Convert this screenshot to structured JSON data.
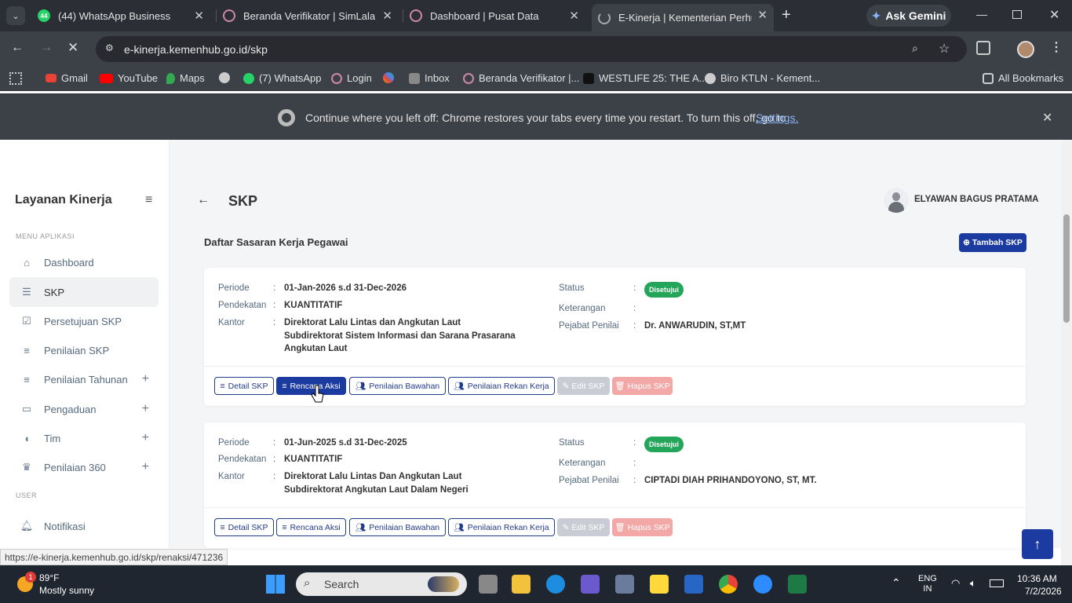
{
  "browser": {
    "tabs": [
      {
        "label": "(44) WhatsApp Business",
        "badge": "44"
      },
      {
        "label": "Beranda Verifikator | SimLala"
      },
      {
        "label": "Dashboard | Pusat Data"
      },
      {
        "label": "E-Kinerja | Kementerian Perhub"
      }
    ],
    "ask_gemini": "Ask Gemini",
    "url": "e-kinerja.kemenhub.go.id/skp",
    "bookmarks": [
      "Gmail",
      "YouTube",
      "Maps",
      "(7) WhatsApp",
      "Login",
      "Inbox",
      "Beranda Verifikator |...",
      "WESTLIFE 25: THE A...",
      "Biro KTLN - Kement..."
    ],
    "bookmark_badge": "44",
    "all_bookmarks": "All Bookmarks",
    "restore_message": "Continue where you left off: Chrome restores your tabs every time you restart. To turn this off, go to",
    "restore_link": "Settings.",
    "status_url": "https://e-kinerja.kemenhub.go.id/skp/renaksi/471236"
  },
  "sidebar": {
    "brand": "Layanan Kinerja",
    "section_menu": "MENU APLIKASI",
    "items": [
      {
        "label": "Dashboard"
      },
      {
        "label": "SKP"
      },
      {
        "label": "Persetujuan SKP"
      },
      {
        "label": "Penilaian SKP"
      },
      {
        "label": "Penilaian Tahunan"
      },
      {
        "label": "Pengaduan"
      },
      {
        "label": "Tim"
      },
      {
        "label": "Penilaian 360"
      }
    ],
    "section_user": "USER",
    "notif": "Notifikasi"
  },
  "header": {
    "title": "SKP",
    "user_name": "ELYAWAN BAGUS PRATAMA"
  },
  "main": {
    "subtitle": "Daftar Sasaran Kerja Pegawai",
    "add_button": "Tambah SKP",
    "labels": {
      "periode": "Periode",
      "pendekatan": "Pendekatan",
      "kantor": "Kantor",
      "status": "Status",
      "keterangan": "Keterangan",
      "pejabat": "Pejabat Penilai",
      "colon": ":"
    },
    "buttons": {
      "detail": "Detail SKP",
      "rencana": "Rencana Aksi",
      "bawahan": "Penilaian Bawahan",
      "rekan": "Penilaian Rekan Kerja",
      "edit": "Edit SKP",
      "hapus": "Hapus SKP"
    },
    "skp": [
      {
        "periode": "01-Jan-2026 s.d 31-Dec-2026",
        "pendekatan": "KUANTITATIF",
        "kantor1": "Direktorat Lalu Lintas dan Angkutan Laut",
        "kantor2": "Subdirektorat Sistem Informasi dan Sarana Prasarana",
        "kantor3": "Angkutan Laut",
        "status": "Disetujui",
        "keterangan": "",
        "pejabat": "Dr. ANWARUDIN, ST,MT"
      },
      {
        "periode": "01-Jun-2025 s.d 31-Dec-2025",
        "pendekatan": "KUANTITATIF",
        "kantor1": "Direktorat Lalu Lintas Dan Angkutan Laut",
        "kantor2": "Subdirektorat Angkutan Laut Dalam Negeri",
        "status": "Disetujui",
        "keterangan": "",
        "pejabat": "CIPTADI DIAH PRIHANDOYONO, ST, MT."
      }
    ]
  },
  "taskbar": {
    "weather_temp": "89°F",
    "weather_desc": "Mostly sunny",
    "weather_badge": "1",
    "search": "Search",
    "lang1": "ENG",
    "lang2": "IN",
    "time": "10:36 AM",
    "date": "7/2/2026"
  }
}
